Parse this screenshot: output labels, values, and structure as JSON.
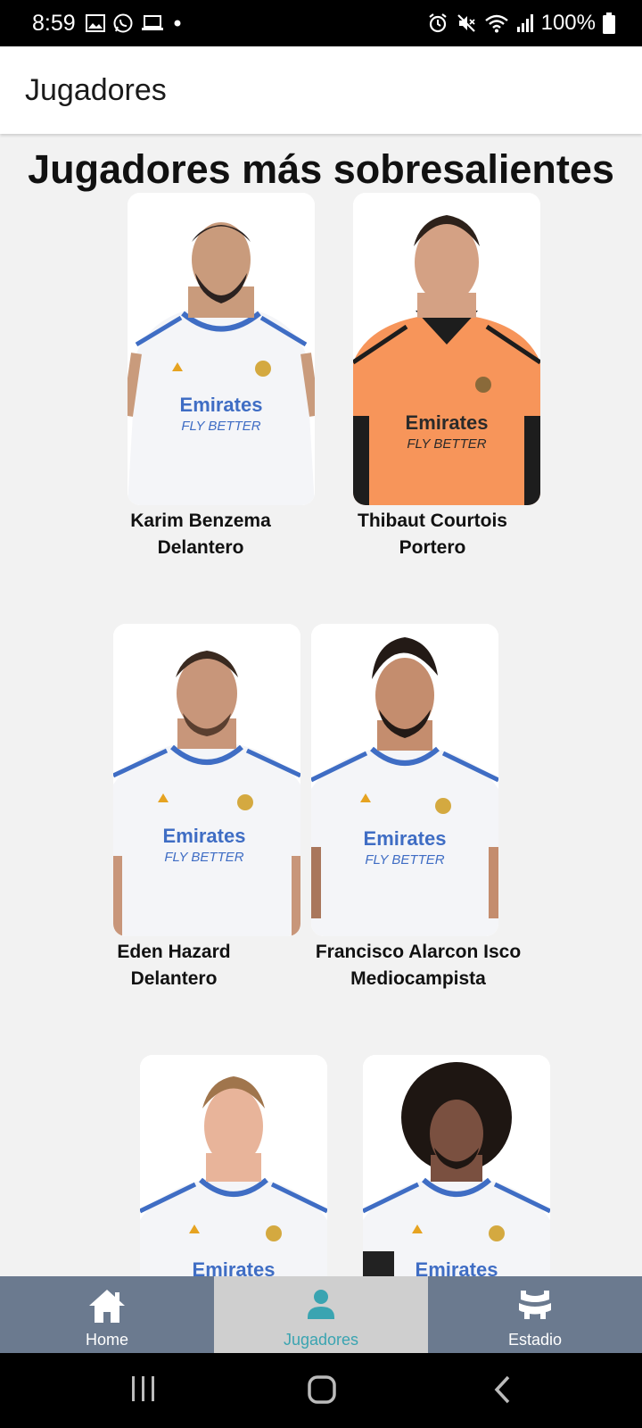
{
  "status_bar": {
    "time": "8:59",
    "battery": "100%",
    "left_icons": [
      "image-icon",
      "whatsapp-icon",
      "laptop-icon",
      "dot-icon"
    ],
    "right_icons": [
      "alarm-icon",
      "mute-icon",
      "wifi-icon",
      "signal-icon",
      "battery-icon"
    ]
  },
  "app_bar": {
    "title": "Jugadores"
  },
  "main": {
    "heading": "Jugadores más sobresalientes",
    "players": [
      {
        "name": "Karim Benzema",
        "position": "Delantero",
        "kit": "white"
      },
      {
        "name": "Thibaut Courtois",
        "position": "Portero",
        "kit": "orange"
      },
      {
        "name": "Eden Hazard",
        "position": "Delantero",
        "kit": "white"
      },
      {
        "name": "Francisco Alarcon Isco",
        "position": "Mediocampista",
        "kit": "white"
      },
      {
        "name": "",
        "position": "",
        "kit": "white"
      },
      {
        "name": "",
        "position": "",
        "kit": "white"
      }
    ]
  },
  "bottom_nav": {
    "items": [
      {
        "label": "Home",
        "icon": "home-icon",
        "active": false
      },
      {
        "label": "Jugadores",
        "icon": "person-icon",
        "active": true
      },
      {
        "label": "Estadio",
        "icon": "stadium-icon",
        "active": false
      }
    ]
  },
  "colors": {
    "nav_bg": "#6b7a8f",
    "nav_active_bg": "#cfcfcf",
    "nav_active_fg": "#3aa4b1",
    "page_bg": "#f2f2f2"
  }
}
